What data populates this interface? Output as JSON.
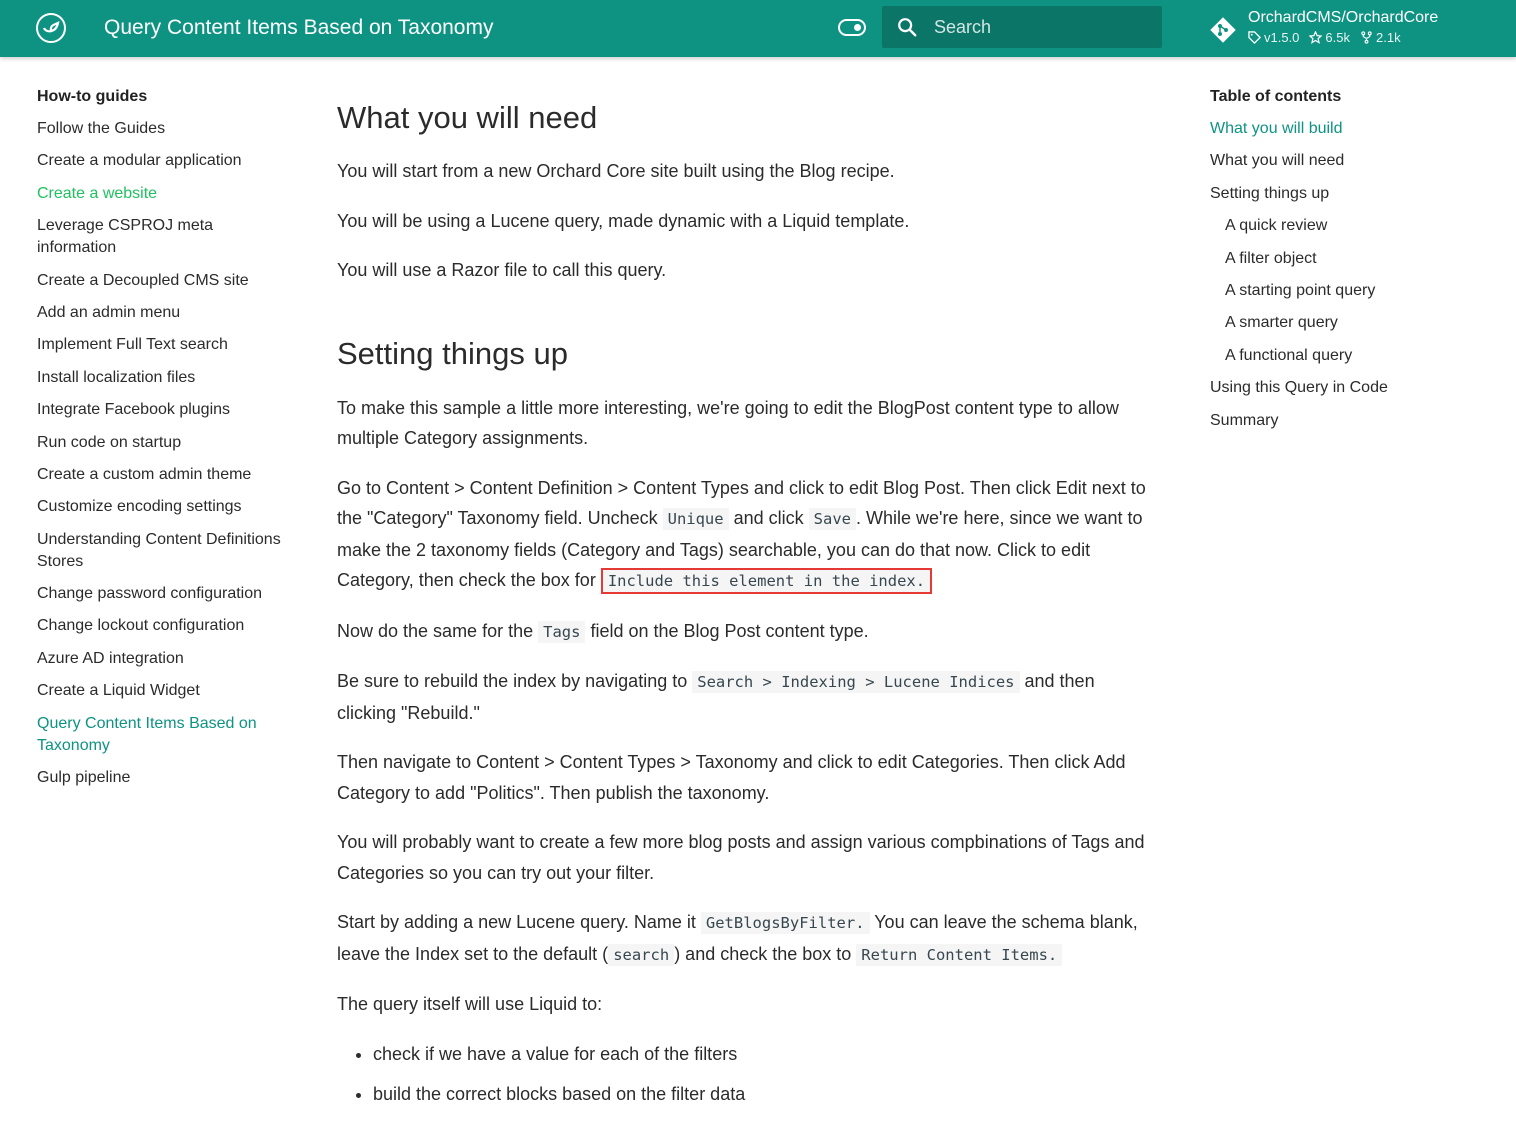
{
  "header": {
    "title": "Query Content Items Based on Taxonomy",
    "search_placeholder": "Search",
    "repo_name": "OrchardCMS/OrchardCore",
    "version": "v1.5.0",
    "stars": "6.5k",
    "forks": "2.1k"
  },
  "sidebar": {
    "title": "How-to guides",
    "items": [
      "Follow the Guides",
      "Create a modular application",
      "Create a website",
      "Leverage CSPROJ meta information",
      "Create a Decoupled CMS site",
      "Add an admin menu",
      "Implement Full Text search",
      "Install localization files",
      "Integrate Facebook plugins",
      "Run code on startup",
      "Create a custom admin theme",
      "Customize encoding settings",
      "Understanding Content Definitions Stores",
      "Change password configuration",
      "Change lockout configuration",
      "Azure AD integration",
      "Create a Liquid Widget",
      "Query Content Items Based on Taxonomy",
      "Gulp pipeline"
    ]
  },
  "content": {
    "h_need": "What you will need",
    "p1": "You will start from a new Orchard Core site built using the Blog recipe.",
    "p2": "You will be using a Lucene query, made dynamic with a Liquid template.",
    "p3": "You will use a Razor file to call this query.",
    "h_setup": "Setting things up",
    "p4": "To make this sample a little more interesting, we're going to edit the BlogPost content type to allow multiple Category assignments.",
    "p5a": "Go to Content > Content Definition > Content Types and click to edit Blog Post. Then click Edit next to the \"Category\" Taxonomy field. Uncheck ",
    "p5_code1": "Unique",
    "p5b": " and click ",
    "p5_code2": "Save",
    "p5c": ". While we're here, since we want to make the 2 taxonomy fields (Category and Tags) searchable, you can do that now. Click to edit Category, then check the box for ",
    "p5_code3": "Include this element in the index.",
    "p6a": "Now do the same for the ",
    "p6_code": "Tags",
    "p6b": " field on the Blog Post content type.",
    "p7a": "Be sure to rebuild the index by navigating to ",
    "p7_code": "Search > Indexing > Lucene Indices",
    "p7b": " and then clicking \"Rebuild.\"",
    "p8": "Then navigate to Content > Content Types > Taxonomy and click to edit Categories. Then click Add Category to add \"Politics\". Then publish the taxonomy.",
    "p9": "You will probably want to create a few more blog posts and assign various compbinations of Tags and Categories so you can try out your filter.",
    "p10a": "Start by adding a new Lucene query. Name it ",
    "p10_code1": "GetBlogsByFilter.",
    "p10b": " You can leave the schema blank, leave the Index set to the default (",
    "p10_code2": "search",
    "p10c": ") and check the box to ",
    "p10_code3": "Return Content Items.",
    "p11": "The query itself will use Liquid to:",
    "li1": "check if we have a value for each of the filters",
    "li2": "build the correct blocks based on the filter data"
  },
  "toc": {
    "title": "Table of contents",
    "items": [
      "What you will build",
      "What you will need",
      "Setting things up",
      "A quick review",
      "A filter object",
      "A starting point query",
      "A smarter query",
      "A functional query",
      "Using this Query in Code",
      "Summary"
    ]
  },
  "colors": {
    "header": "#0e9383",
    "active_link_green": "#20c060",
    "active_link_teal": "#0e9383",
    "highlight_border": "#e53935"
  }
}
